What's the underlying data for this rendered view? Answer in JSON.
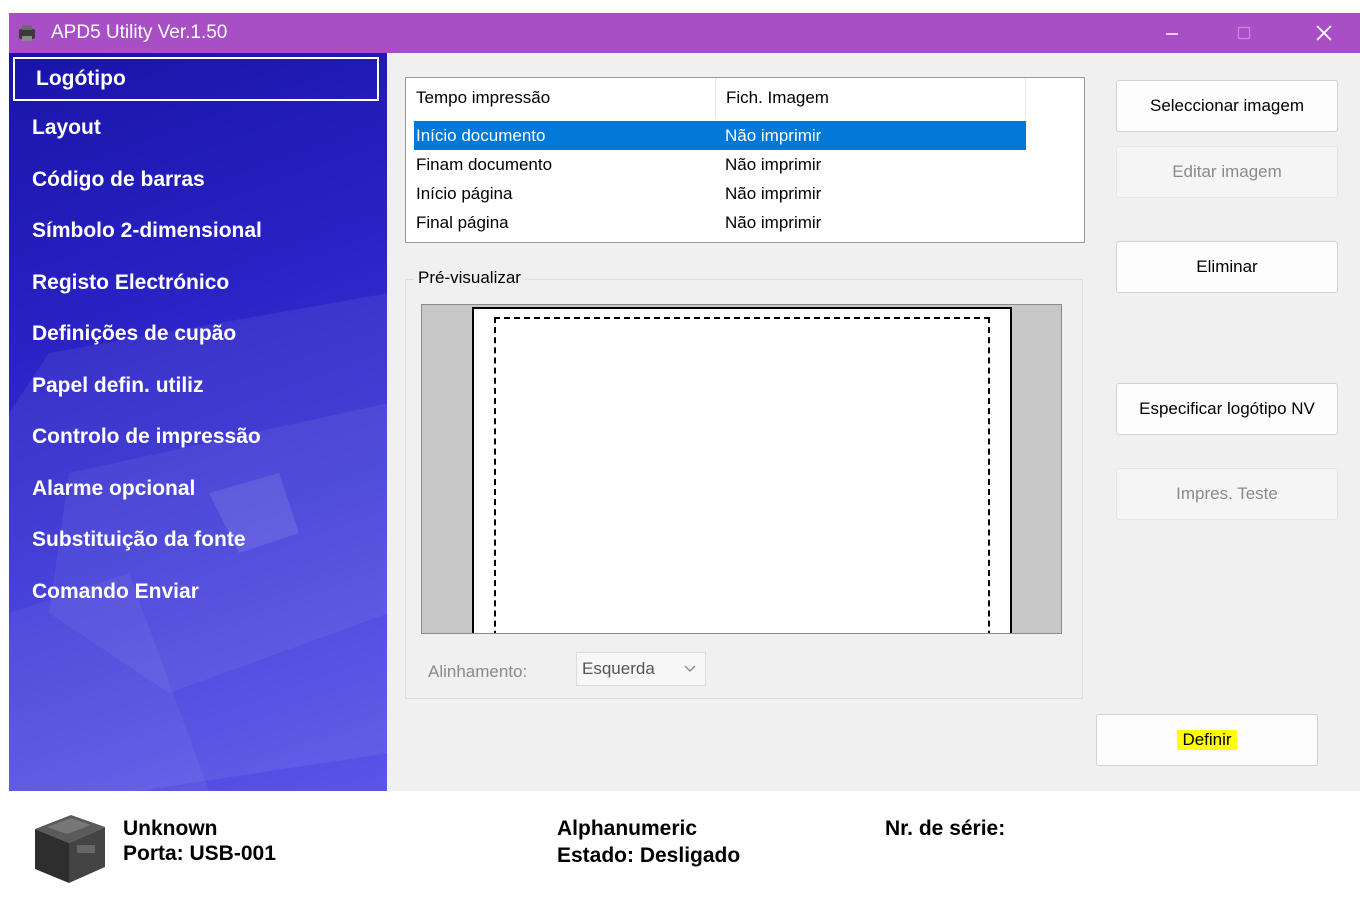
{
  "window": {
    "title": "APD5 Utility Ver.1.50"
  },
  "sidebar": {
    "items": [
      {
        "label": "Logótipo",
        "selected": true
      },
      {
        "label": "Layout"
      },
      {
        "label": "Código de barras"
      },
      {
        "label": "Símbolo 2-dimensional"
      },
      {
        "label": "Registo Electrónico"
      },
      {
        "label": "Definições de cupão"
      },
      {
        "label": "Papel defin. utiliz"
      },
      {
        "label": "Controlo de impressão"
      },
      {
        "label": "Alarme opcional"
      },
      {
        "label": "Substituição da fonte"
      },
      {
        "label": "Comando Enviar"
      }
    ]
  },
  "logo_list": {
    "columns": [
      "Tempo impressão",
      "Fich. Imagem"
    ],
    "rows": [
      {
        "timing": "Início documento",
        "image": "Não imprimir",
        "selected": true
      },
      {
        "timing": "Finam documento",
        "image": "Não imprimir"
      },
      {
        "timing": "Início página",
        "image": "Não imprimir"
      },
      {
        "timing": "Final página",
        "image": "Não imprimir"
      }
    ]
  },
  "preview": {
    "title": "Pré-visualizar",
    "alignment_label": "Alinhamento:",
    "alignment_value": "Esquerda"
  },
  "buttons": {
    "select_image": "Seleccionar imagem",
    "edit_image": "Editar imagem",
    "delete": "Eliminar",
    "specify_nv_logo": "Especificar logótipo NV",
    "test_print": "Impres. Teste",
    "define": "Definir"
  },
  "status": {
    "model": "Unknown",
    "port": "Porta: USB-001",
    "mode": "Alphanumeric",
    "state": "Estado: Desligado",
    "serial_label": "Nr. de série:"
  },
  "colors": {
    "titlebar": "#a94fc6",
    "selection": "#0078d7",
    "highlight": "#ffff00"
  }
}
